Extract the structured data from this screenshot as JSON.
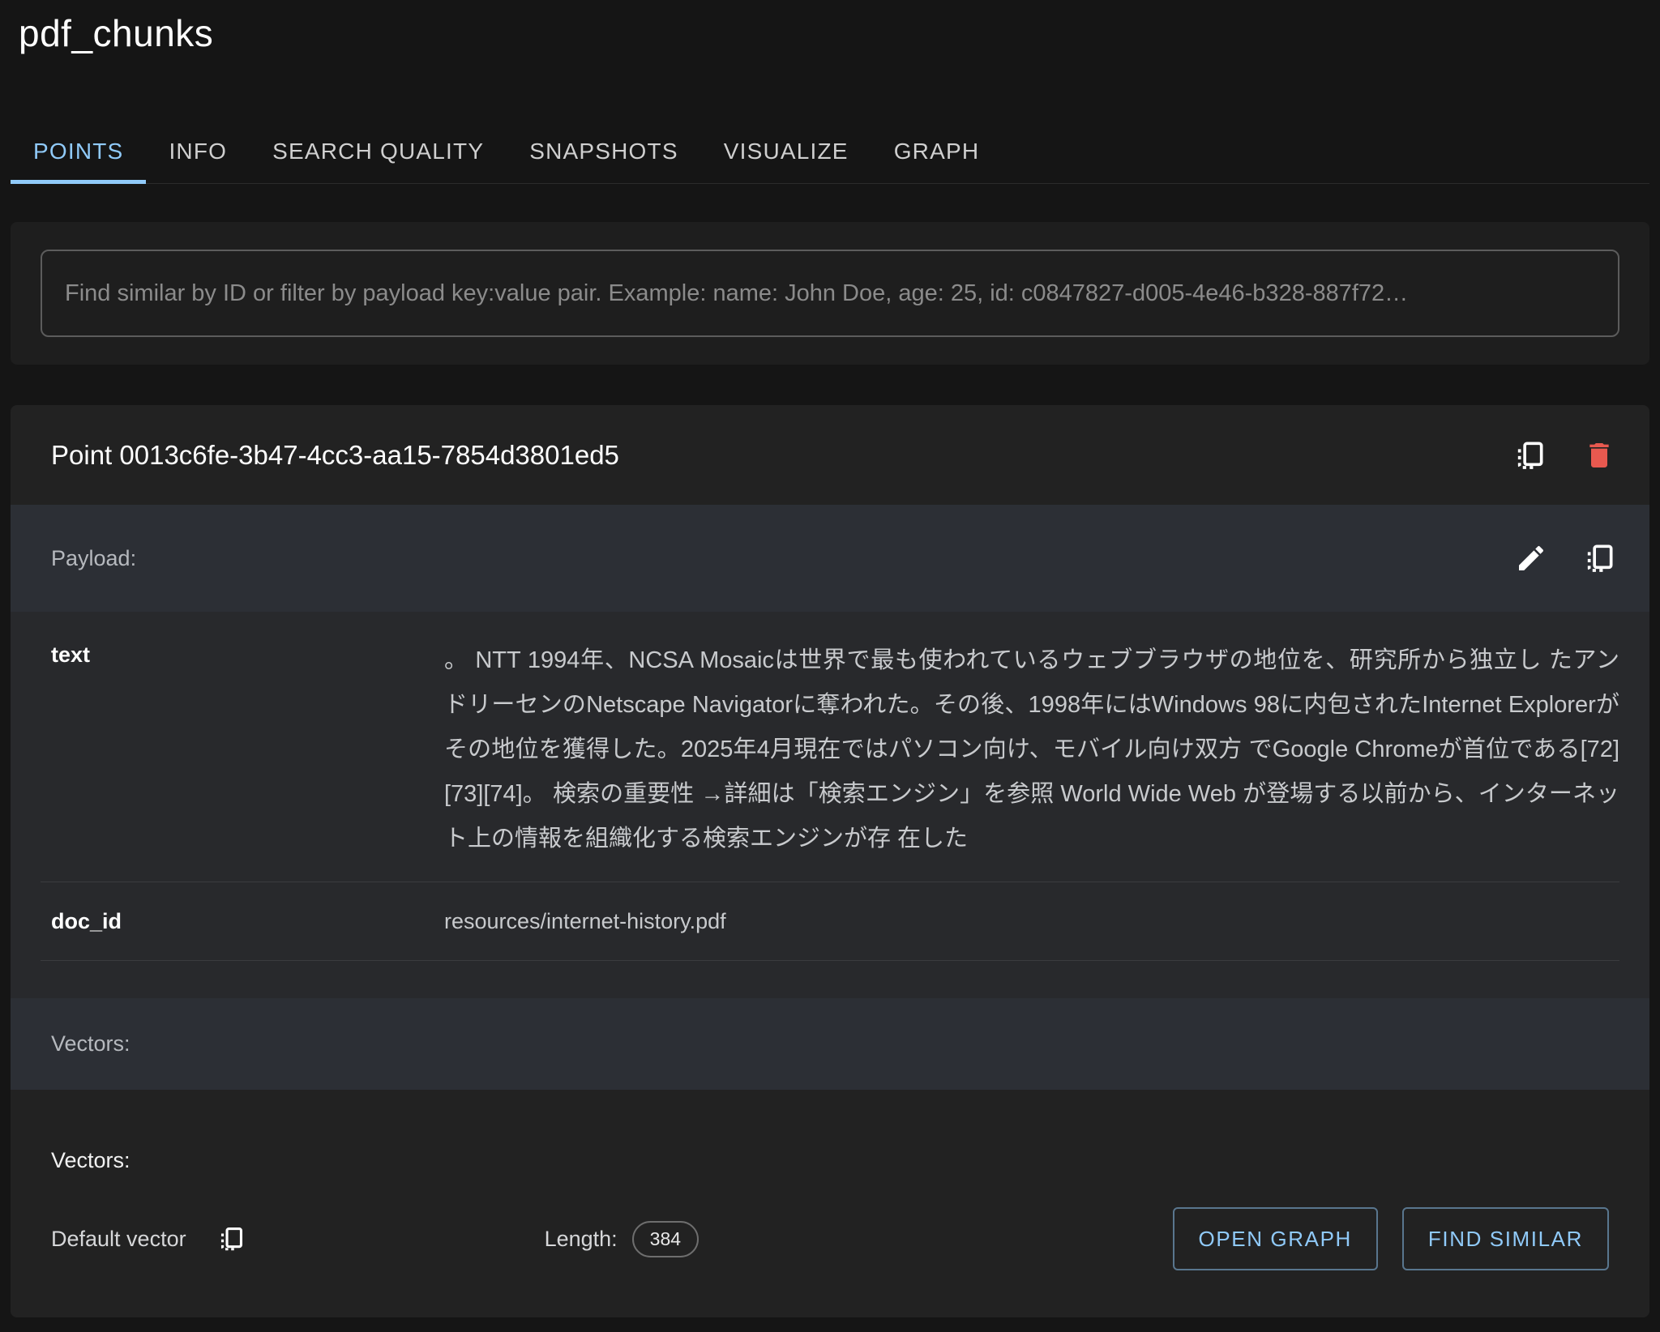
{
  "header": {
    "title": "pdf_chunks"
  },
  "tabs": [
    {
      "label": "POINTS",
      "active": true
    },
    {
      "label": "INFO",
      "active": false
    },
    {
      "label": "SEARCH QUALITY",
      "active": false
    },
    {
      "label": "SNAPSHOTS",
      "active": false
    },
    {
      "label": "VISUALIZE",
      "active": false
    },
    {
      "label": "GRAPH",
      "active": false
    }
  ],
  "search": {
    "placeholder": "Find similar by ID or filter by payload key:value pair. Example: name: John Doe, age: 25, id: c0847827-d005-4e46-b328-887f72…"
  },
  "point": {
    "title": "Point 0013c6fe-3b47-4cc3-aa15-7854d3801ed5",
    "payload_label": "Payload:",
    "fields": [
      {
        "key": "text",
        "value": "。 NTT 1994年、NCSA Mosaicは世界で最も使われているウェブブラウザの地位を、研究所から独立し たアンドリーセンのNetscape Navigatorに奪われた。その後、1998年にはWindows 98に内包されたInternet Explorerがその地位を獲得した。2025年4月現在ではパソコン向け、モバイル向け双方 でGoogle Chromeが首位である[72][73][74]。 検索の重要性 →詳細は「検索エンジン」を参照 World Wide Web が登場する以前から、インターネット上の情報を組織化する検索エンジンが存 在した"
      },
      {
        "key": "doc_id",
        "value": "resources/internet-history.pdf"
      }
    ],
    "vectors_band_label": "Vectors:",
    "vectors_heading": "Vectors:",
    "default_vector_label": "Default vector",
    "length_label": "Length:",
    "length_value": "384",
    "buttons": {
      "open_graph": "OPEN GRAPH",
      "find_similar": "FIND SIMILAR"
    }
  },
  "icons": {
    "copy_point": "copy-all-icon",
    "delete_point": "trash-icon",
    "edit_payload": "edit-pencil-icon",
    "copy_payload": "copy-all-icon",
    "copy_vector": "copy-all-icon"
  },
  "colors": {
    "accent": "#90caf9",
    "danger": "#e8594f"
  }
}
